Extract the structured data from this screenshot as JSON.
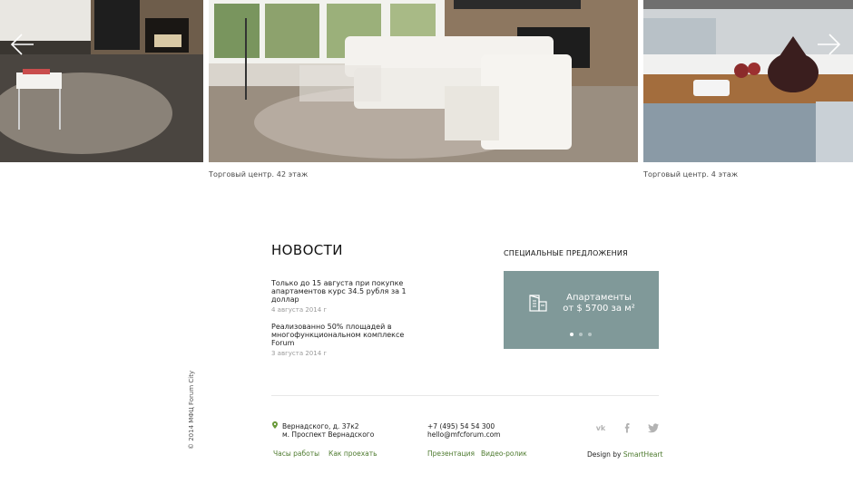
{
  "slider": {
    "captions": [
      "Торговый центр. 42 этаж",
      "Торговый центр. 4 этаж"
    ],
    "prev_icon": "arrow-left-icon",
    "next_icon": "arrow-right-icon"
  },
  "news": {
    "title": "НОВОСТИ",
    "items": [
      {
        "title": "Только до 15 августа при покупке апартаментов курс 34.5 рубля за 1 доллар",
        "date": "4 августа 2014 г"
      },
      {
        "title": "Реализованно 50% площадей в многофункциональном комплексе Forum",
        "date": "3 августа 2014 г"
      }
    ]
  },
  "special": {
    "title": "СПЕЦИАЛЬНЫЕ ПРЕДЛОЖЕНИЯ",
    "offer_line1": "Апартаменты",
    "offer_line2": "от $ 5700 за м²",
    "icon": "building-icon",
    "bg_color": "#809999"
  },
  "footer": {
    "copyright": "© 2014 МФЦ Forum City",
    "address_line1": "Вернадского, д. 37к2",
    "address_line2": "м. Проспект Вернадского",
    "phone": "+7 (495) 54 54 300",
    "email": "hello@mfcforum.com",
    "links": [
      "Часы работы",
      "Как проехать",
      "Презентация",
      "Видео-ролик"
    ],
    "design_prefix": "Design by ",
    "design_link": "SmartHeart",
    "social_icons": [
      "vk-icon",
      "facebook-icon",
      "twitter-icon"
    ],
    "link_color": "#4d7a2e"
  }
}
